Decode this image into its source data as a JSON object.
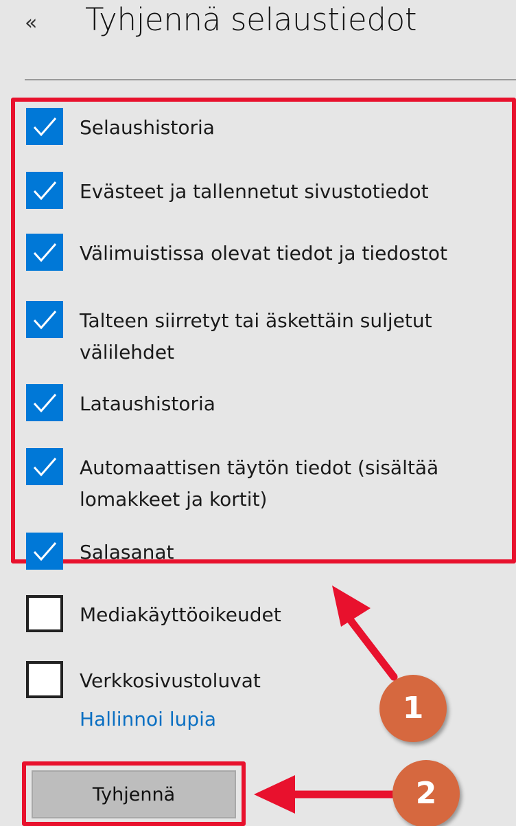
{
  "header": {
    "back_glyph": "«",
    "title": "Tyhjennä selaustiedot"
  },
  "options": [
    {
      "label_lines": [
        "Selaushistoria"
      ],
      "checked": true
    },
    {
      "label_lines": [
        "Evästeet ja tallennetut sivustotiedot"
      ],
      "checked": true
    },
    {
      "label_lines": [
        "Välimuistissa olevat tiedot ja tiedostot"
      ],
      "checked": true
    },
    {
      "label_lines": [
        "Talteen siirretyt tai äskettäin suljetut",
        "välilehdet"
      ],
      "checked": true
    },
    {
      "label_lines": [
        "Lataushistoria"
      ],
      "checked": true
    },
    {
      "label_lines": [
        "Automaattisen täytön tiedot (sisältää",
        "lomakkeet ja kortit)"
      ],
      "checked": true
    },
    {
      "label_lines": [
        "Salasanat"
      ],
      "checked": true
    },
    {
      "label_lines": [
        "Mediakäyttöoikeudet"
      ],
      "checked": false
    },
    {
      "label_lines": [
        "Verkkosivustoluvat"
      ],
      "checked": false
    }
  ],
  "manage_link": "Hallinnoi lupia",
  "clear_button": "Tyhjennä",
  "annotations": {
    "badge_1": "1",
    "badge_2": "2",
    "highlight_color": "#e8112d",
    "badge_color": "#d6683f",
    "checkbox_accent": "#0078d7"
  }
}
